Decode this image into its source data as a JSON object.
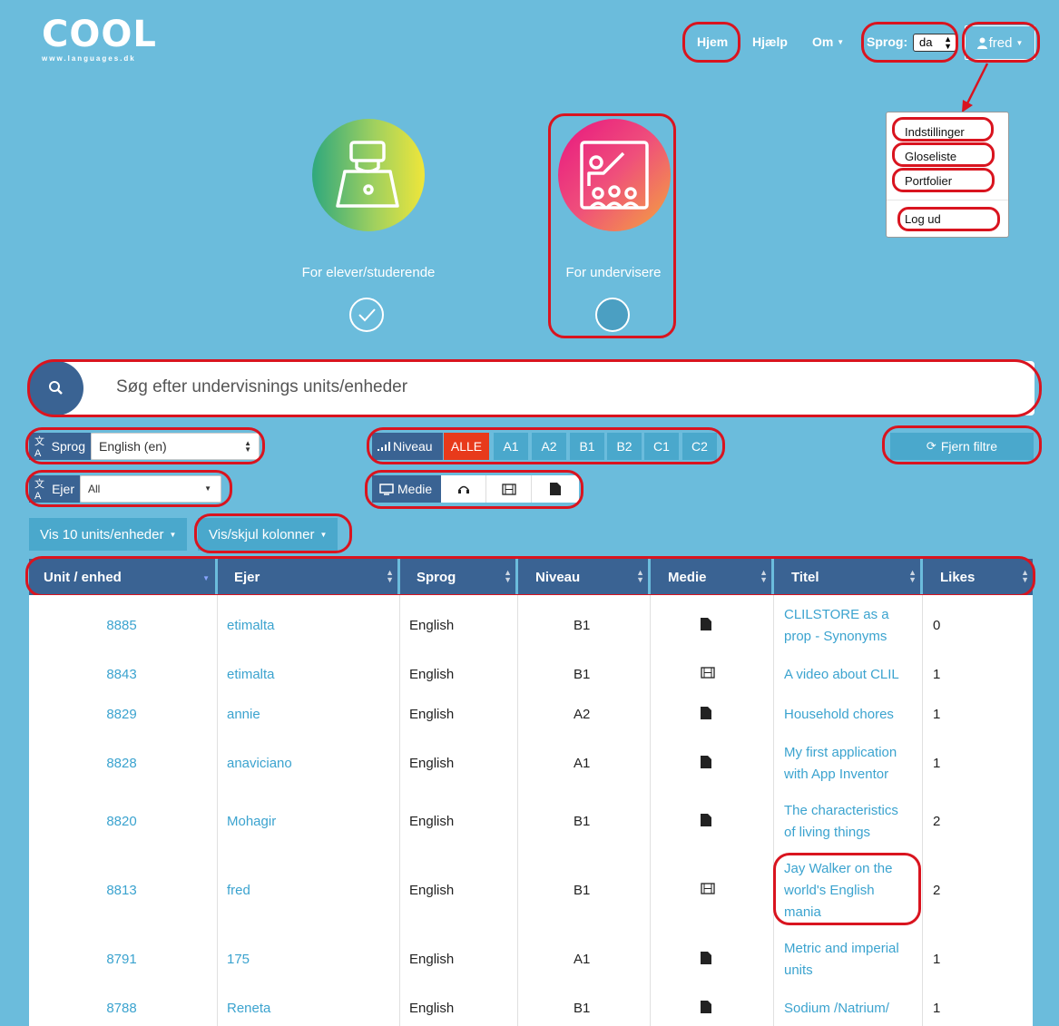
{
  "logo": {
    "word": "COOL",
    "sub": "www.languages.dk"
  },
  "nav": {
    "home": "Hjem",
    "help": "Hjælp",
    "about": "Om",
    "language_label": "Sprog:",
    "language_value": "da",
    "user": "fred"
  },
  "user_menu": [
    "Indstillinger",
    "Gloseliste",
    "Portfolier",
    "Log ud"
  ],
  "roles": {
    "student": "For elever/studerende",
    "teacher": "For undervisere"
  },
  "search": {
    "placeholder": "Søg efter undervisnings units/enheder"
  },
  "filters": {
    "language_label": "Sprog",
    "language_value": "English (en)",
    "owner_label": "Ejer",
    "owner_value": "All",
    "level_label": "Niveau",
    "levels": [
      "ALLE",
      "A1",
      "A2",
      "B1",
      "B2",
      "C1",
      "C2"
    ],
    "media_label": "Medie",
    "media_icons": [
      "headphones-icon",
      "film-icon",
      "document-icon"
    ],
    "clear": "Fjern filtre"
  },
  "toolbar": {
    "show_count": "Vis 10 units/enheder",
    "toggle_columns": "Vis/skjul kolonner"
  },
  "colors": {
    "background": "#6bbcdc",
    "header": "#3a6393",
    "accent": "#4aa8cc",
    "active_level": "#e83a1b",
    "highlight": "#d9141f"
  },
  "table": {
    "columns": [
      "Unit / enhed",
      "Ejer",
      "Sprog",
      "Niveau",
      "Medie",
      "Titel",
      "Likes"
    ],
    "rows": [
      {
        "unit": "8885",
        "owner": "etimalta",
        "lang": "English",
        "level": "B1",
        "media": "document",
        "title1": "CLILSTORE as a",
        "title2": "prop - Synonyms",
        "title3": "",
        "likes": "0"
      },
      {
        "unit": "8843",
        "owner": "etimalta",
        "lang": "English",
        "level": "B1",
        "media": "film",
        "title1": "A video about CLIL",
        "title2": "",
        "title3": "",
        "likes": "1"
      },
      {
        "unit": "8829",
        "owner": "annie",
        "lang": "English",
        "level": "A2",
        "media": "document",
        "title1": "Household chores",
        "title2": "",
        "title3": "",
        "likes": "1"
      },
      {
        "unit": "8828",
        "owner": "anaviciano",
        "lang": "English",
        "level": "A1",
        "media": "document",
        "title1": "My first application",
        "title2": "with App Inventor",
        "title3": "",
        "likes": "1"
      },
      {
        "unit": "8820",
        "owner": "Mohagir",
        "lang": "English",
        "level": "B1",
        "media": "document",
        "title1": "The characteristics",
        "title2": "of living things",
        "title3": "",
        "likes": "2"
      },
      {
        "unit": "8813",
        "owner": "fred",
        "lang": "English",
        "level": "B1",
        "media": "film",
        "title1": "Jay Walker on the",
        "title2": "world's English",
        "title3": "mania",
        "likes": "2"
      },
      {
        "unit": "8791",
        "owner": "175",
        "lang": "English",
        "level": "A1",
        "media": "document",
        "title1": "Metric and imperial",
        "title2": "units",
        "title3": "",
        "likes": "1"
      },
      {
        "unit": "8788",
        "owner": "Reneta",
        "lang": "English",
        "level": "B1",
        "media": "document",
        "title1": "Sodium /Natrium/",
        "title2": "",
        "title3": "",
        "likes": "1"
      }
    ]
  }
}
